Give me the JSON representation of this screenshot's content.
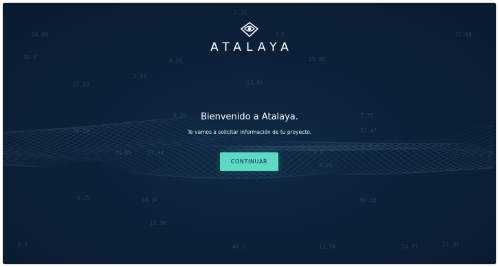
{
  "brand": {
    "logo_icon": "eye-diamond-icon",
    "name": "ATALAYA",
    "text_color": "#ffffff"
  },
  "welcome": {
    "title": "Bienvenido a Atalaya.",
    "subtitle": "Te vamos a solicitar información de tu proyecto."
  },
  "actions": {
    "continue_label": "CONTINUAR",
    "continue_color": "#5fd8c4"
  },
  "background": {
    "base_color": "#0c2139",
    "wave_color": "#7fa6c4",
    "decorative_numbers": [
      "2.25",
      "24.86",
      "3.8",
      "31.84",
      "35.0",
      "4.10",
      "25.85",
      "2.84",
      "27.52",
      "23.01",
      "0.26",
      "7.75",
      "24.50",
      "3.8",
      "53.47",
      "24.8%",
      "21.44",
      "3.24",
      "0.25",
      "30.34",
      "60.05",
      "12.36",
      "0.2",
      "21.91",
      "40.6",
      "12.54",
      "14.71"
    ]
  }
}
